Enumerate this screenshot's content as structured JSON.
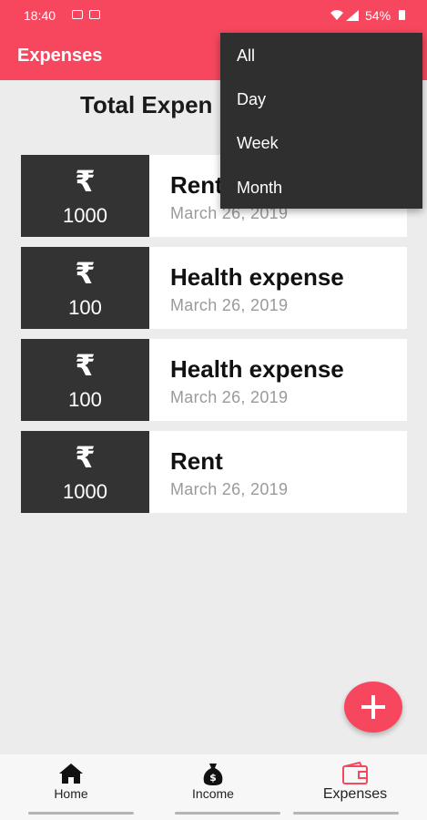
{
  "status_bar": {
    "time": "18:40",
    "battery": "54%"
  },
  "app_bar": {
    "title": "Expenses",
    "background": "#f6475e"
  },
  "summary": {
    "total_label": "Total Expen"
  },
  "expenses": [
    {
      "currency": "₹",
      "amount": "1000",
      "name": "Rent",
      "date": "March 26, 2019"
    },
    {
      "currency": "₹",
      "amount": "100",
      "name": "Health expense",
      "date": "March 26, 2019"
    },
    {
      "currency": "₹",
      "amount": "100",
      "name": "Health expense",
      "date": "March 26, 2019"
    },
    {
      "currency": "₹",
      "amount": "1000",
      "name": "Rent",
      "date": "March 26, 2019"
    }
  ],
  "filter_menu": {
    "items": [
      "All",
      "Day",
      "Week",
      "Month"
    ]
  },
  "fab": {
    "icon": "plus-icon"
  },
  "bottom_nav": {
    "items": [
      {
        "label": "Home",
        "icon": "home-icon"
      },
      {
        "label": "Income",
        "icon": "money-bag-icon"
      },
      {
        "label": "Expenses",
        "icon": "wallet-icon",
        "active": true
      }
    ]
  }
}
